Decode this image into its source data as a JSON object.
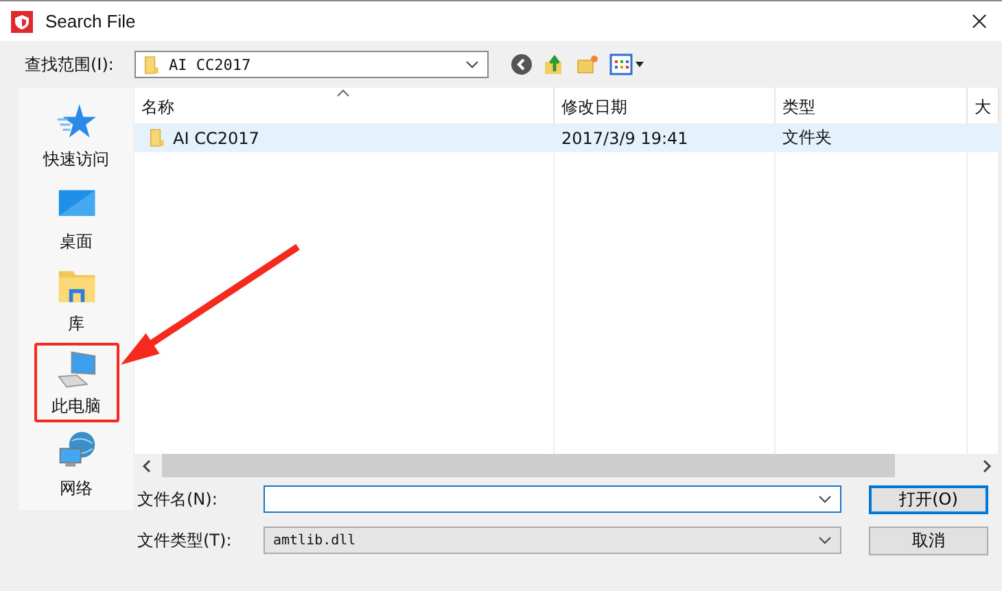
{
  "window": {
    "title": "Search File"
  },
  "look_in": {
    "label": "查找范围(I):",
    "value": "AI CC2017"
  },
  "sidebar": {
    "items": [
      {
        "label": "快速访问",
        "kind": "star",
        "highlighted": false
      },
      {
        "label": "桌面",
        "kind": "desktop",
        "highlighted": false
      },
      {
        "label": "库",
        "kind": "library",
        "highlighted": false
      },
      {
        "label": "此电脑",
        "kind": "computer",
        "highlighted": true
      },
      {
        "label": "网络",
        "kind": "network",
        "highlighted": false
      }
    ]
  },
  "pointer_arrow": true,
  "table": {
    "columns": [
      "名称",
      "修改日期",
      "类型",
      "大"
    ],
    "rows": [
      {
        "cells": [
          "AI CC2017",
          "2017/3/9 19:41",
          "文件夹"
        ],
        "selected": true
      }
    ]
  },
  "file_name": {
    "label": "文件名(N):"
  },
  "file_type": {
    "label": "文件类型(T):",
    "value": "amtlib.dll"
  },
  "buttons": [
    "打开(O)",
    "取消"
  ]
}
